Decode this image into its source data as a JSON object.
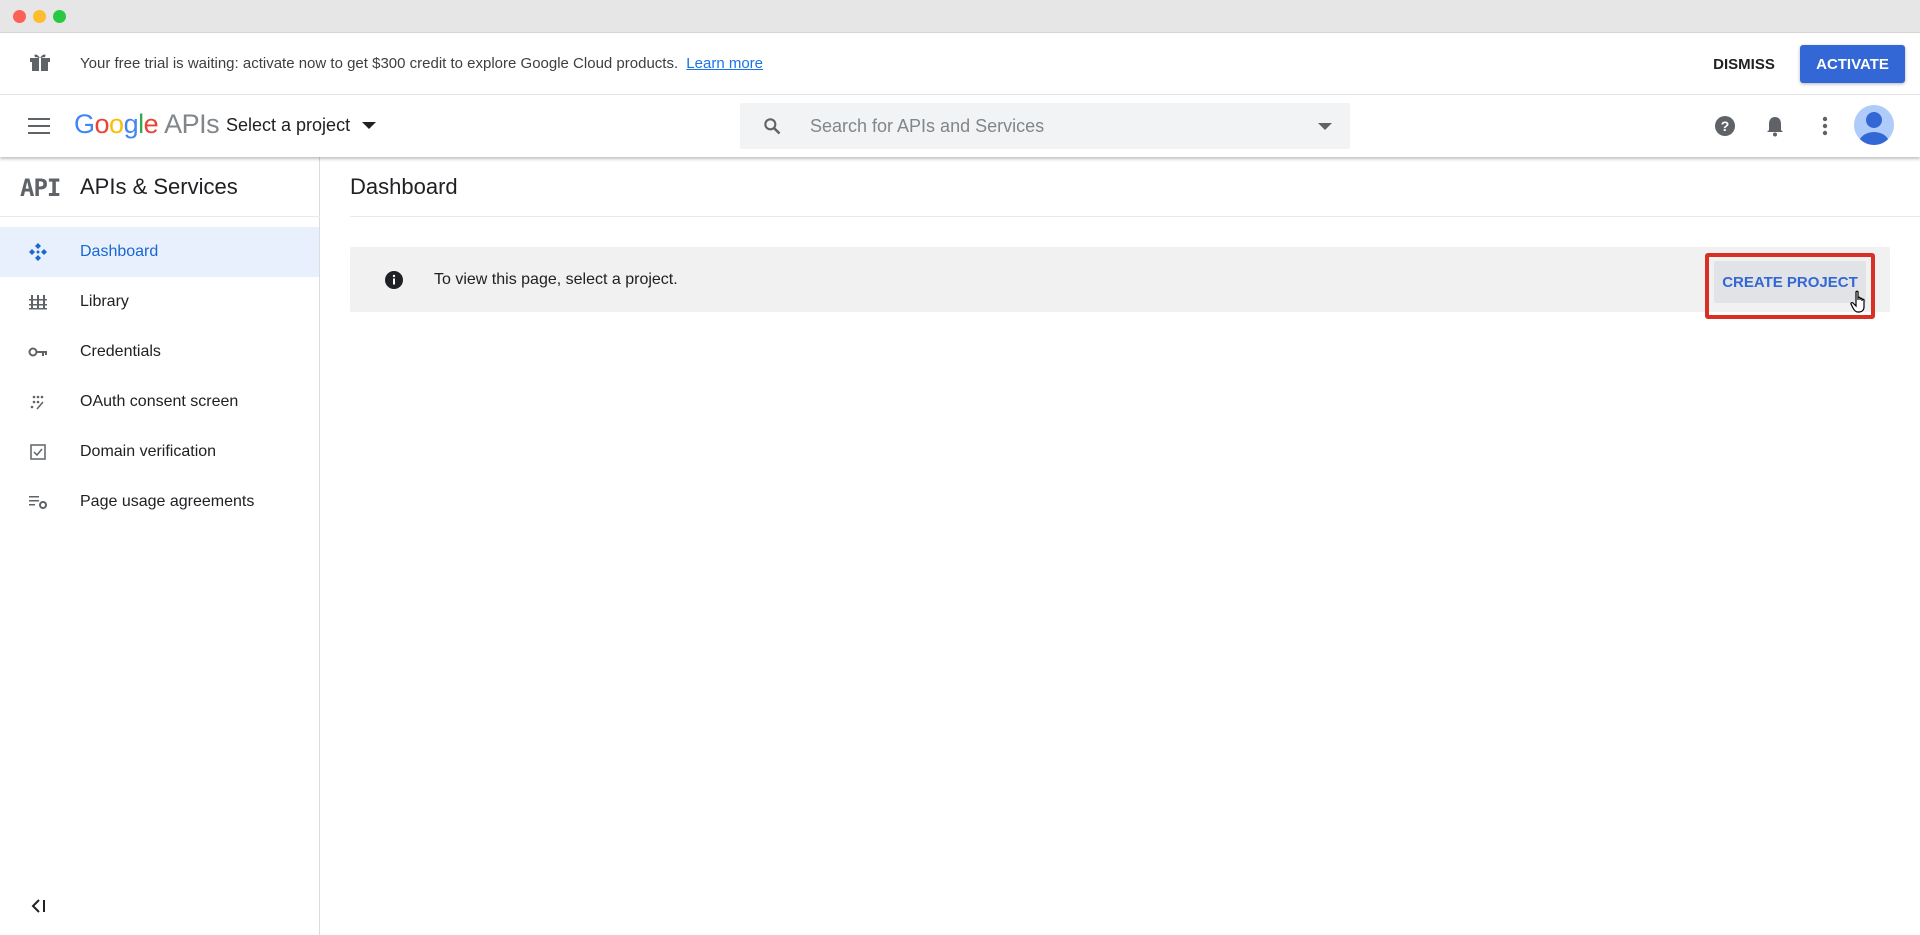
{
  "window": {
    "controls": [
      "close",
      "minimize",
      "maximize"
    ]
  },
  "trial_banner": {
    "message": "Your free trial is waiting: activate now to get $300 credit to explore Google Cloud products.",
    "learn_more": "Learn more",
    "dismiss_label": "DISMISS",
    "activate_label": "ACTIVATE",
    "icon": "gift-icon"
  },
  "header": {
    "logo_google": [
      "G",
      "o",
      "o",
      "g",
      "l",
      "e"
    ],
    "logo_apis": "APIs",
    "project_select": "Select a project",
    "search_placeholder": "Search for APIs and Services",
    "icons": [
      "menu-icon",
      "search-icon",
      "help-icon",
      "notifications-icon",
      "more-vert-icon",
      "account-avatar"
    ]
  },
  "sidebar": {
    "logo_text": "API",
    "title": "APIs & Services",
    "items": [
      {
        "label": "Dashboard",
        "icon": "dashboard-icon",
        "active": true
      },
      {
        "label": "Library",
        "icon": "library-icon",
        "active": false
      },
      {
        "label": "Credentials",
        "icon": "key-icon",
        "active": false
      },
      {
        "label": "OAuth consent screen",
        "icon": "oauth-consent-icon",
        "active": false
      },
      {
        "label": "Domain verification",
        "icon": "domain-verification-icon",
        "active": false
      },
      {
        "label": "Page usage agreements",
        "icon": "page-usage-icon",
        "active": false
      }
    ],
    "collapse_icon": "collapse-sidebar-icon"
  },
  "main": {
    "title": "Dashboard",
    "notice_text": "To view this page, select a project.",
    "create_project_label": "CREATE PROJECT"
  },
  "colors": {
    "accent": "#3367d6",
    "active_bg": "#e8f0fe",
    "highlight_border": "#d93025"
  }
}
